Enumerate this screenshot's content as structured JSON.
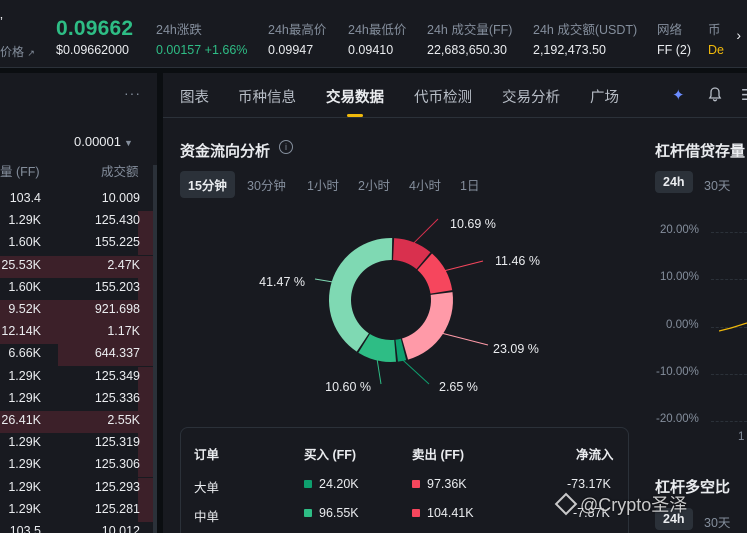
{
  "ticker": {
    "pair_fragment": "’",
    "mark_label": "价格",
    "price": "0.09662",
    "price_usd": "$0.09662000",
    "stats": [
      {
        "label": "24h涨跌",
        "value": "0.00157 +1.66%"
      },
      {
        "label": "24h最高价",
        "value": "0.09947"
      },
      {
        "label": "24h最低价",
        "value": "0.09410"
      },
      {
        "label": "24h 成交量(FF)",
        "value": "22,683,650.30"
      },
      {
        "label": "24h 成交额(USDT)",
        "value": "2,192,473.50"
      },
      {
        "label": "网络",
        "value": "FF (2)"
      },
      {
        "label": "币",
        "value": "De"
      }
    ]
  },
  "orderbook": {
    "tick_size": "0.00001",
    "col_amount": "量 (FF)",
    "col_total": "成交额",
    "rows": [
      {
        "amount": "103.4",
        "total": "10.009",
        "depth": 0
      },
      {
        "amount": "1.29K",
        "total": "125.430",
        "depth": 0.1
      },
      {
        "amount": "1.60K",
        "total": "155.225",
        "depth": 0.1
      },
      {
        "amount": "25.53K",
        "total": "2.47K",
        "depth": 1.0
      },
      {
        "amount": "1.60K",
        "total": "155.203",
        "depth": 0.1
      },
      {
        "amount": "9.52K",
        "total": "921.698",
        "depth": 1.0
      },
      {
        "amount": "12.14K",
        "total": "1.17K",
        "depth": 1.0
      },
      {
        "amount": "6.66K",
        "total": "644.337",
        "depth": 0.62
      },
      {
        "amount": "1.29K",
        "total": "125.349",
        "depth": 0.1
      },
      {
        "amount": "1.29K",
        "total": "125.336",
        "depth": 0.1
      },
      {
        "amount": "26.41K",
        "total": "2.55K",
        "depth": 1.0
      },
      {
        "amount": "1.29K",
        "total": "125.319",
        "depth": 0.1
      },
      {
        "amount": "1.29K",
        "total": "125.306",
        "depth": 0.1
      },
      {
        "amount": "1.29K",
        "total": "125.293",
        "depth": 0.1
      },
      {
        "amount": "1.29K",
        "total": "125.281",
        "depth": 0.1
      },
      {
        "amount": "103.5",
        "total": "10.012",
        "depth": 0
      }
    ]
  },
  "tabs": [
    "图表",
    "币种信息",
    "交易数据",
    "代币检测",
    "交易分析",
    "广场"
  ],
  "fund_flow": {
    "title": "资金流向分析",
    "periods": [
      "15分钟",
      "30分钟",
      "1小时",
      "2小时",
      "4小时",
      "1日"
    ],
    "active_period": "15分钟"
  },
  "chart_data": {
    "type": "pie",
    "labels": [
      "10.69 %",
      "11.46 %",
      "23.09 %",
      "2.65 %",
      "10.60 %",
      "41.47 %"
    ],
    "values": [
      10.69,
      11.46,
      23.09,
      2.65,
      10.6,
      41.47
    ],
    "colors": [
      "#d9304e",
      "#f6465d",
      "#ff9aa8",
      "#0e9f6e",
      "#2ebd85",
      "#7fd9b3"
    ]
  },
  "order_table": {
    "headers": [
      "订单",
      "买入 (FF)",
      "卖出 (FF)",
      "净流入"
    ],
    "rows": [
      {
        "type": "大单",
        "buy": "24.20K",
        "sell": "97.36K",
        "net": "-73.17K",
        "buy_color": "#0e9f6e",
        "sell_color": "#f6465d"
      },
      {
        "type": "中单",
        "buy": "96.55K",
        "sell": "104.41K",
        "net": "-7.87K",
        "buy_color": "#2ebd85",
        "sell_color": "#f6465d"
      }
    ]
  },
  "leverage": {
    "title": "杠杆借贷存量",
    "periods": [
      "24h",
      "30天"
    ],
    "y_ticks": [
      "20.00%",
      "10.00%",
      "0.00%",
      "-10.00%",
      "-20.00%"
    ],
    "x_tick_fragment": "1",
    "ratio_title": "杠杆多空比",
    "ratio_periods": [
      "24h",
      "30天"
    ]
  },
  "watermark": "@Crypto圣泽"
}
